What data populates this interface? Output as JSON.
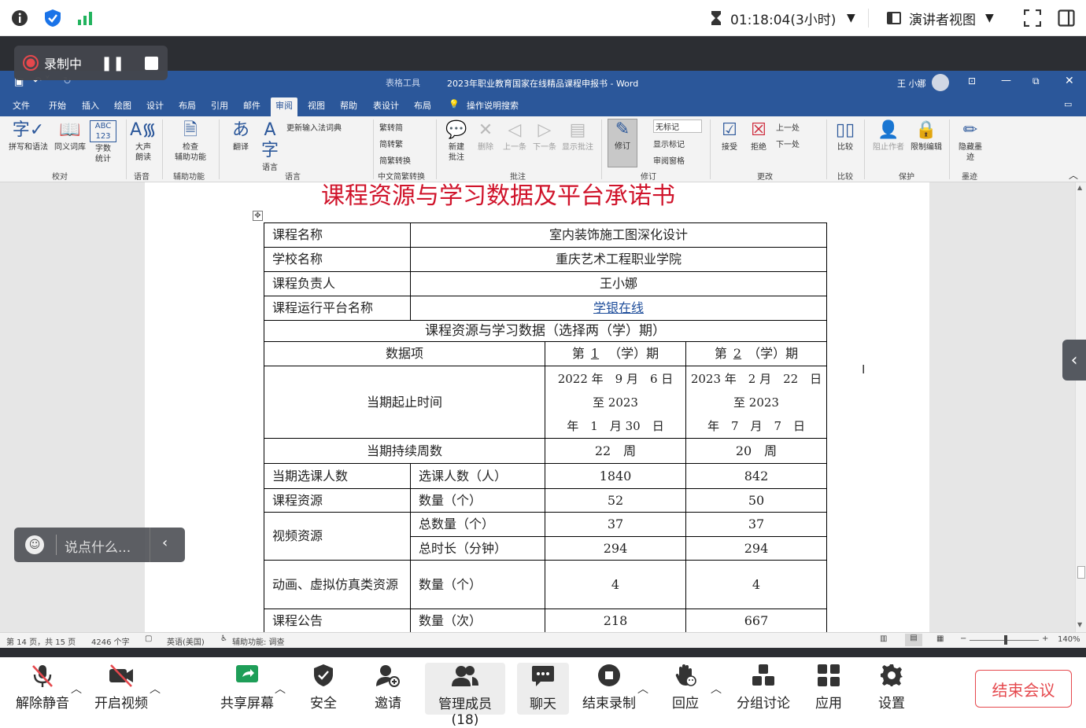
{
  "meeting_top": {
    "timer": "01:18:04(3小时)",
    "view_label": "演讲者视图"
  },
  "recording": {
    "label": "录制中"
  },
  "word": {
    "table_tools": "表格工具",
    "doc_title": "2023年职业教育国家在线精品课程申报书 - Word",
    "user": "王 小娜",
    "tabs": [
      "文件",
      "开始",
      "插入",
      "绘图",
      "设计",
      "布局",
      "引用",
      "邮件",
      "审阅",
      "视图",
      "帮助",
      "表设计",
      "布局"
    ],
    "active_tab": "审阅",
    "tell_me": "操作说明搜索",
    "ribbon": {
      "spell": "拼写和语法",
      "thesaurus": "同义词库",
      "wordcount_top": "ABC\n123",
      "wordcount": "字数\n统计",
      "readaloud": "大声\n朗读",
      "check_a11y": "检查\n辅助功能",
      "translate": "翻译",
      "language": "语言",
      "update_ime": "更新输入法词典",
      "to_trad": "繁转简",
      "to_simp": "简转繁",
      "conv": "简繁转换",
      "new_comment": "新建\n批注",
      "delete": "删除",
      "prev": "上一条",
      "next": "下一条",
      "show_comments": "显示批注",
      "track": "修订",
      "no_markup": "无标记",
      "show_markup": "显示标记",
      "review_pane": "审阅窗格",
      "accept": "接受",
      "reject": "拒绝",
      "prev_change": "上一处",
      "next_change": "下一处",
      "compare": "比较",
      "block_authors": "阻止作者",
      "restrict": "限制编辑",
      "hide_ink": "隐藏墨\n迹",
      "groups": [
        "校对",
        "语音",
        "辅助功能",
        "语言",
        "中文简繁转换",
        "批注",
        "修订",
        "更改",
        "比较",
        "保护",
        "墨迹"
      ]
    },
    "status": {
      "page": "第 14 页，共 15 页",
      "words": "4246 个字",
      "lang": "英语(美国)",
      "a11y": "辅助功能: 调查",
      "zoom": "140%"
    }
  },
  "document": {
    "heading": "课程资源与学习数据及平台承诺书",
    "table": {
      "course_name_label": "课程名称",
      "course_name": "室内装饰施工图深化设计",
      "school_label": "学校名称",
      "school": "重庆艺术工程职业学院",
      "lead_label": "课程负责人",
      "lead": "王小娜",
      "platform_label": "课程运行平台名称",
      "platform": "学银在线",
      "section_title": "课程资源与学习数据（选择两（学）期）",
      "data_item": "数据项",
      "period1": {
        "pre": "第",
        "num": "1",
        "post": "（学）期"
      },
      "period2": {
        "pre": "第",
        "num": "2",
        "post": "（学）期"
      },
      "start_time_label": "当期起止时间",
      "p1_time": [
        "2022 年　9 月　6 日",
        "至 2023",
        "年　1　月 30　日"
      ],
      "p2_time": [
        "2023 年　2 月　22　日",
        "至 2023",
        "年　7　月　7　日"
      ],
      "weeks_label": "当期持续周数",
      "p1_weeks": "22　周",
      "p2_weeks": "20　周",
      "rows": [
        {
          "label": "当期选课人数",
          "sub": "选课人数（人）",
          "v1": "1840",
          "v2": "842"
        },
        {
          "label": "课程资源",
          "sub": "数量（个）",
          "v1": "52",
          "v2": "50"
        },
        {
          "label": "视频资源",
          "sub": "总数量（个）",
          "v1": "37",
          "v2": "37"
        },
        {
          "label": "",
          "sub": "总时长（分钟）",
          "v1": "294",
          "v2": "294"
        },
        {
          "label": "动画、虚拟仿真类资源",
          "sub": "数量（个）",
          "v1": "4",
          "v2": "4"
        },
        {
          "label": "课程公告",
          "sub": "数量（次）",
          "v1": "218",
          "v2": "667"
        }
      ]
    }
  },
  "chat_box": {
    "placeholder": "说点什么..."
  },
  "bottom_toolbar": {
    "unmute": "解除静音",
    "video": "开启视频",
    "share": "共享屏幕",
    "security": "安全",
    "invite": "邀请",
    "participants": "管理成员(18)",
    "chat": "聊天",
    "end_record": "结束录制",
    "react": "回应",
    "breakout": "分组讨论",
    "apps": "应用",
    "settings": "设置",
    "end_meeting": "结束会议"
  },
  "colors": {
    "word_blue": "#2b579a",
    "end_red": "#e5484d",
    "shield_blue": "#1a73e8",
    "signal_green": "#22b35e"
  }
}
